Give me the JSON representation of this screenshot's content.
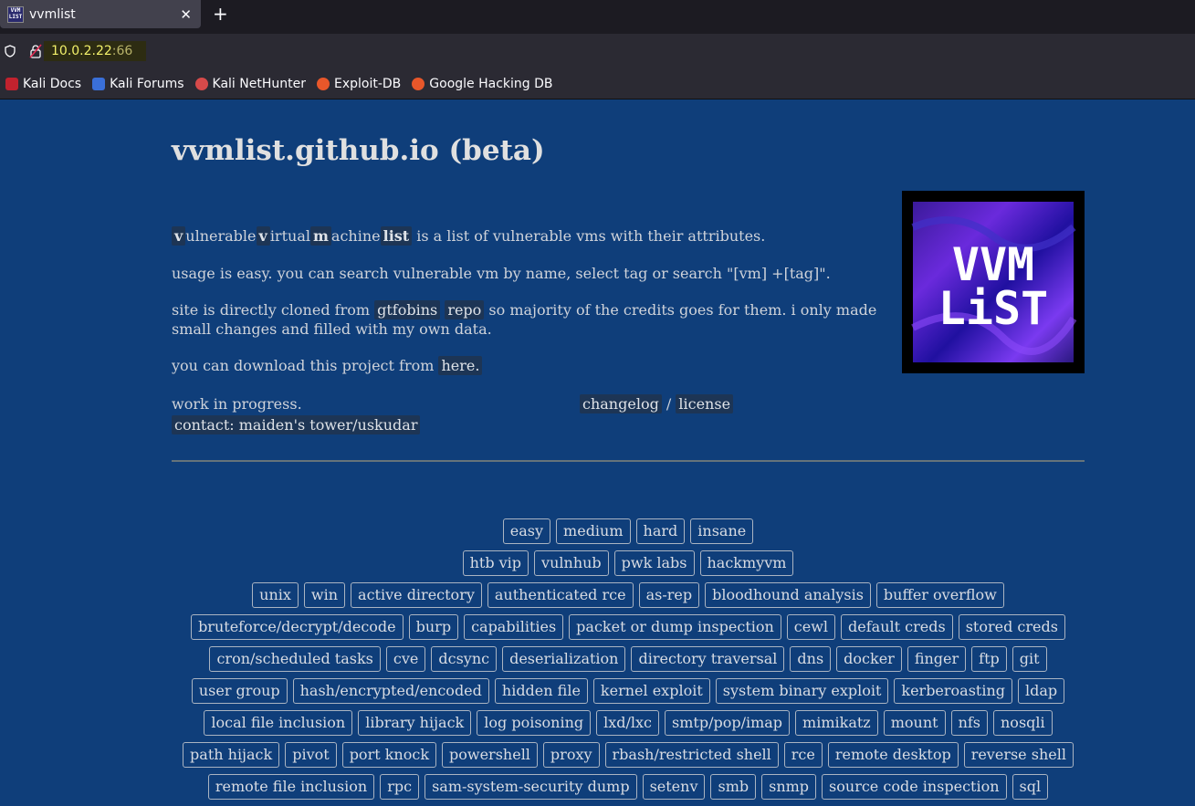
{
  "browser": {
    "tab_title": "vvmlist",
    "favicon_text": "VVM LIST",
    "url_host": "10.0.2.22",
    "url_port": ":66",
    "bookmarks": [
      "Kali Docs",
      "Kali Forums",
      "Kali NetHunter",
      "Exploit-DB",
      "Google Hacking DB"
    ]
  },
  "page": {
    "title": "vvmlist.github.io (beta)",
    "intro": {
      "v1": "v",
      "w1": "ulnerable",
      "v2": "v",
      "w2": "irtual",
      "m": "m",
      "w3": "achine",
      "list": "list",
      "rest": " is a list of vulnerable vms with their attributes."
    },
    "usage": "usage is easy. you can search vulnerable vm by name, select tag or search \"[vm] +[tag]\".",
    "clone": {
      "pre": "site is directly cloned from ",
      "gtfobins": "gtfobins",
      "repo": "repo",
      "post": " so majority of the credits goes for them. i only made small changes and filled with my own data."
    },
    "download": {
      "pre": "you can download this project from ",
      "link": "here."
    },
    "wip": "work in progress.",
    "changelog": "changelog",
    "sep": "/",
    "license": "license",
    "contact": "contact: maiden's tower/uskudar",
    "logo_text": [
      "VVM",
      "LiST"
    ]
  },
  "tag_rows": [
    [
      "easy",
      "medium",
      "hard",
      "insane"
    ],
    [
      "htb vip",
      "vulnhub",
      "pwk labs",
      "hackmyvm"
    ],
    [
      "unix",
      "win",
      "active directory",
      "authenticated rce",
      "as-rep",
      "bloodhound analysis",
      "buffer overflow"
    ],
    [
      "bruteforce/decrypt/decode",
      "burp",
      "capabilities",
      "packet or dump inspection",
      "cewl",
      "default creds",
      "stored creds"
    ],
    [
      "cron/scheduled tasks",
      "cve",
      "dcsync",
      "deserialization",
      "directory traversal",
      "dns",
      "docker",
      "finger",
      "ftp",
      "git"
    ],
    [
      "user group",
      "hash/encrypted/encoded",
      "hidden file",
      "kernel exploit",
      "system binary exploit",
      "kerberoasting",
      "ldap"
    ],
    [
      "local file inclusion",
      "library hijack",
      "log poisoning",
      "lxd/lxc",
      "smtp/pop/imap",
      "mimikatz",
      "mount",
      "nfs",
      "nosqli"
    ],
    [
      "path hijack",
      "pivot",
      "port knock",
      "powershell",
      "proxy",
      "rbash/restricted shell",
      "rce",
      "remote desktop",
      "reverse shell"
    ],
    [
      "remote file inclusion",
      "rpc",
      "sam-system-security dump",
      "setenv",
      "smb",
      "snmp",
      "source code inspection",
      "sql"
    ]
  ]
}
